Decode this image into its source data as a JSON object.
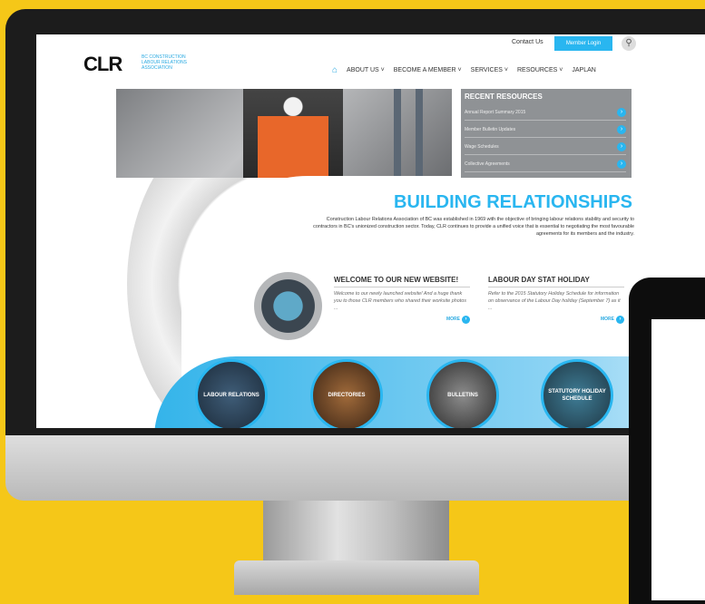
{
  "header": {
    "logo": "CLR",
    "tagline": "BC CONSTRUCTION LABOUR RELATIONS ASSOCIATION",
    "contact": "Contact Us",
    "login": "Member Login",
    "search_icon": "search-icon"
  },
  "nav": {
    "home_icon": "home-icon",
    "items": [
      "ABOUT US",
      "BECOME A MEMBER",
      "SERVICES",
      "RESOURCES",
      "JAPLAN"
    ]
  },
  "recent": {
    "title": "RECENT RESOURCES",
    "items": [
      "Annual Report Summary 2015",
      "Member Bulletin Updates",
      "Wage Schedules",
      "Collective Agreements"
    ]
  },
  "hero": {
    "headline": "BUILDING RELATIONSHIPS",
    "intro": "Construction Labour Relations Association of BC was established in 1969 with the objective of bringing labour relations stability and security to contractors in BC's unionized construction sector. Today, CLR continues to provide a unified voice that is essential to negotiating the most favourable agreements for its members and the industry."
  },
  "news": [
    {
      "title": "WELCOME TO OUR NEW WEBSITE!",
      "text": "Welcome to our newly launched website! And a huge thank you to those CLR members who shared their worksite photos ...",
      "more": "MORE"
    },
    {
      "title": "LABOUR DAY STAT HOLIDAY",
      "text": "Refer to the 2015 Statutory Holiday Schedule for information on observance of the Labour Day holiday (September 7) as it ...",
      "more": "MORE"
    }
  ],
  "circles": [
    "LABOUR RELATIONS",
    "DIRECTORIES",
    "BULLETINS",
    "STATUTORY HOLIDAY SCHEDULE"
  ]
}
